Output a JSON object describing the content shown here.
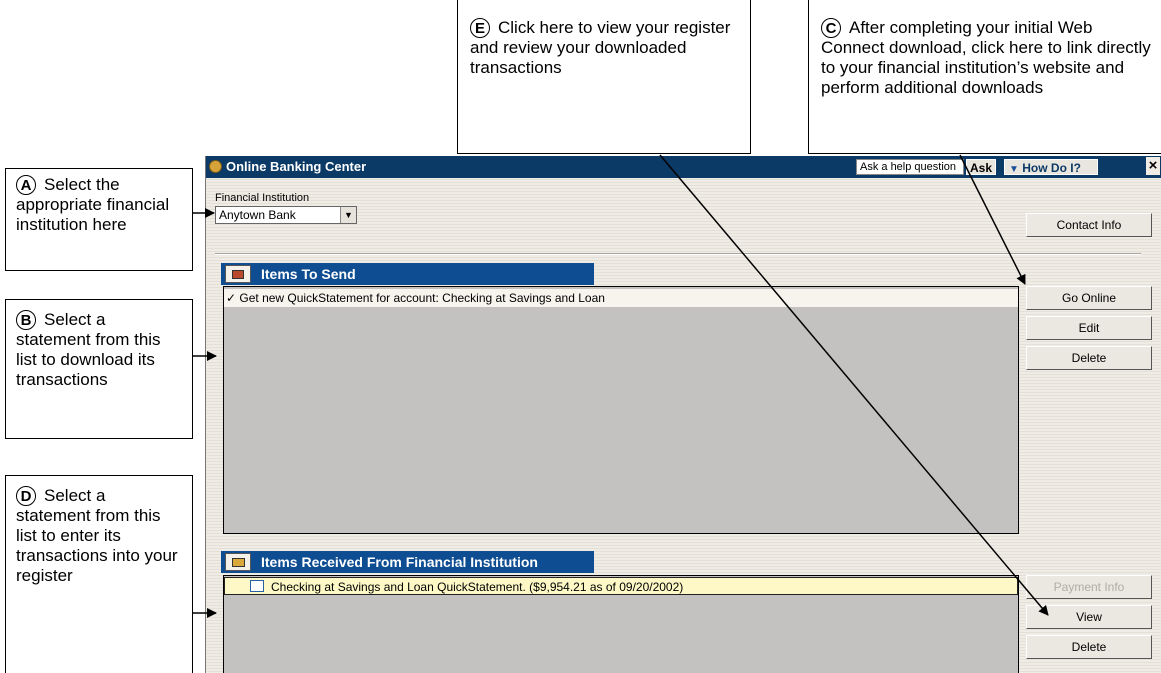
{
  "window": {
    "title": "Online Banking Center",
    "help_placeholder": "Ask a help question",
    "ask_label": "Ask",
    "how_do_label": "How Do I?",
    "close_glyph": "×"
  },
  "fi": {
    "label": "Financial Institution",
    "selected": "Anytown Bank"
  },
  "buttons": {
    "contact_info": "Contact Info",
    "go_online": "Go Online",
    "edit": "Edit",
    "delete_send": "Delete",
    "payment_info": "Payment Info",
    "view": "View",
    "delete_recv": "Delete"
  },
  "send": {
    "header": "Items To Send",
    "items": [
      "✓ Get new QuickStatement for account: Checking at Savings and Loan"
    ]
  },
  "received": {
    "header": "Items Received From Financial Institution",
    "items": [
      "Checking at Savings and Loan QuickStatement.   ($9,954.21 as of 09/20/2002)"
    ]
  },
  "callouts": {
    "A": {
      "letter": "A",
      "text": "Select the appropriate financial institution here"
    },
    "B": {
      "letter": "B",
      "text": "Select a statement from this list to download its transactions"
    },
    "C": {
      "letter": "C",
      "text": "After completing your initial Web Connect download, click here to link directly to your financial institution’s website and perform additional downloads"
    },
    "D": {
      "letter": "D",
      "text": "Select a statement from this list to enter its transactions into your register"
    },
    "E": {
      "letter": "E",
      "text": "Click here to view your register and review your downloaded transactions"
    }
  },
  "colors": {
    "titlebar": "#0c3a66",
    "section_header": "#0f4d92",
    "list_bg": "#c3c2c0",
    "selected_row": "#fdf8c6"
  }
}
